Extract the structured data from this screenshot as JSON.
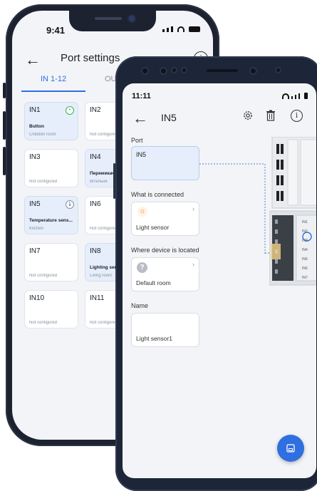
{
  "back_phone": {
    "status_time": "9:41",
    "header_title": "Port settings",
    "tabs": [
      {
        "label": "IN 1-12",
        "active": true
      },
      {
        "label": "OUT",
        "active": false
      }
    ],
    "ports": [
      {
        "name": "IN1",
        "desc": "Button",
        "sub": "Children room",
        "active": true,
        "icon": "button-icon"
      },
      {
        "name": "IN2",
        "desc": "",
        "sub": "Not configured",
        "active": false,
        "icon": ""
      },
      {
        "name": "IN3",
        "desc": "",
        "sub": "Not configured",
        "active": false,
        "icon": ""
      },
      {
        "name": "IN4",
        "desc": "Перемикач",
        "sub": "Вітальня",
        "active": true,
        "icon": ""
      },
      {
        "name": "IN5",
        "desc": "Temperature sens...",
        "sub": "Kitchen",
        "active": true,
        "icon": "thermometer-icon"
      },
      {
        "name": "IN6",
        "desc": "",
        "sub": "Not configured",
        "active": false,
        "icon": ""
      },
      {
        "name": "IN7",
        "desc": "",
        "sub": "Not configured",
        "active": false,
        "icon": ""
      },
      {
        "name": "IN8",
        "desc": "Lighting sen",
        "sub": "Living room",
        "active": true,
        "icon": ""
      },
      {
        "name": "IN10",
        "desc": "",
        "sub": "Not configured",
        "active": false,
        "icon": ""
      },
      {
        "name": "IN11",
        "desc": "",
        "sub": "Not configured",
        "active": false,
        "icon": ""
      }
    ]
  },
  "front_phone": {
    "status_time": "11:11",
    "header_title": "IN5",
    "port_label": "Port",
    "port_value": "IN5",
    "connected_label": "What is connected",
    "connected_value": "Light sensor",
    "location_label": "Where device is located",
    "location_value": "Default room",
    "name_label": "Name",
    "name_value": "Light sensor1",
    "device_labels": [
      "IN1",
      "IN2",
      "IN3",
      "IN4",
      "IN5",
      "IN6",
      "IN7"
    ]
  },
  "colors": {
    "accent": "#2f6fe0",
    "selected_bg": "#e6eefb",
    "phone_frame": "#1c2230",
    "screen_bg": "#f3f4f7"
  }
}
